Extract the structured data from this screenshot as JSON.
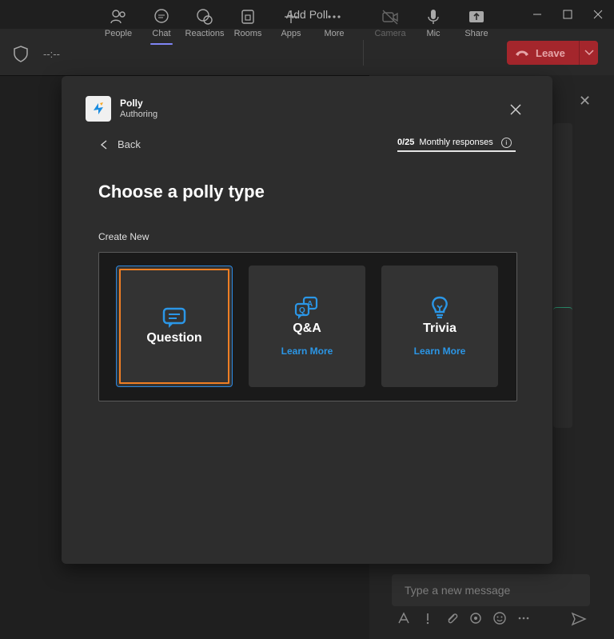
{
  "window": {
    "title": "Add Poll"
  },
  "call": {
    "timer": "--:--",
    "toolbar": [
      {
        "label": "People"
      },
      {
        "label": "Chat"
      },
      {
        "label": "Reactions"
      },
      {
        "label": "Rooms"
      },
      {
        "label": "Apps"
      },
      {
        "label": "More"
      },
      {
        "label": "Camera"
      },
      {
        "label": "Mic"
      },
      {
        "label": "Share"
      }
    ],
    "leave_label": "Leave"
  },
  "chat": {
    "message_placeholder": "Type a new message"
  },
  "dialog": {
    "app_name": "Polly",
    "app_subtitle": "Authoring",
    "back_label": "Back",
    "quota_count": "0/25",
    "quota_label": "Monthly responses",
    "heading": "Choose a polly type",
    "section_label": "Create New",
    "types": [
      {
        "label": "Question",
        "icon": "question-chat-icon"
      },
      {
        "label": "Q&A",
        "icon": "qa-icon",
        "learn_more": "Learn More"
      },
      {
        "label": "Trivia",
        "icon": "lightbulb-icon",
        "learn_more": "Learn More"
      }
    ]
  },
  "colors": {
    "accent_blue": "#2b96e6",
    "leave_red": "#a4262c",
    "highlight_orange": "#f07f24",
    "active_tab": "#7f85f5"
  }
}
